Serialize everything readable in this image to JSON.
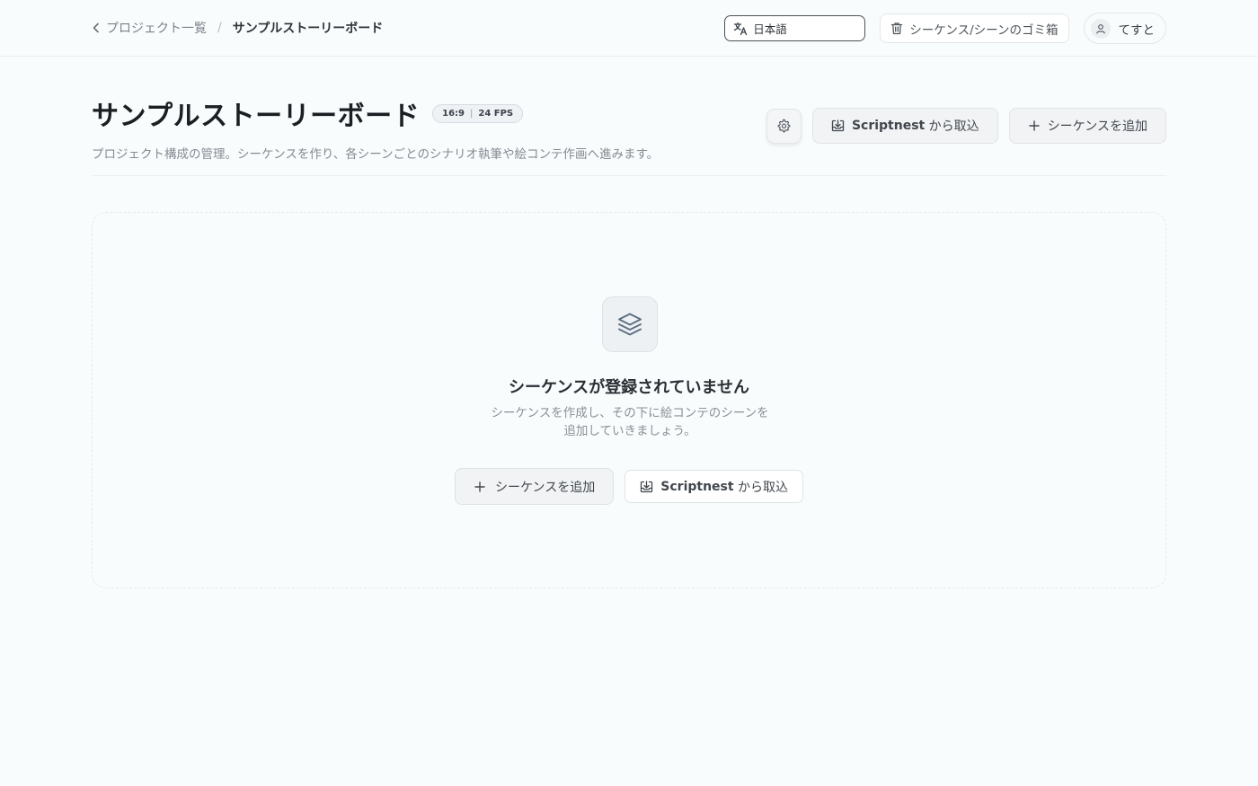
{
  "breadcrumb": {
    "back_label": "プロジェクト一覧",
    "separator": "/",
    "current": "サンプルストーリーボード"
  },
  "topbar": {
    "language": "日本語",
    "trash_label": "シーケンス/シーンのゴミ箱",
    "user_name": "てすと"
  },
  "project": {
    "title": "サンプルストーリーボード",
    "aspect_ratio": "16:9",
    "fps": "24 FPS",
    "description": "プロジェクト構成の管理。シーケンスを作り、各シーンごとのシナリオ執筆や絵コンテ作画へ進みます。"
  },
  "header_actions": {
    "import_brand": "Scriptnest",
    "import_suffix": " から取込",
    "add_sequence": "シーケンスを追加"
  },
  "empty_state": {
    "title": "シーケンスが登録されていません",
    "description": "シーケンスを作成し、その下に絵コンテのシーンを追加していきましょう。",
    "add_label": "シーケンスを追加",
    "import_brand": "Scriptnest",
    "import_suffix": " から取込"
  },
  "icons": {
    "back": "chevron-left-icon",
    "language": "translate-icon",
    "trash": "trash-icon",
    "user": "user-icon",
    "settings": "gear-icon",
    "import": "download-tray-icon",
    "add": "plus-icon",
    "empty": "layers-icon"
  },
  "colors": {
    "background": "#f9fcfd",
    "border": "#e3e6ea",
    "text_primary": "#1b1f23",
    "text_muted": "#858b92"
  }
}
